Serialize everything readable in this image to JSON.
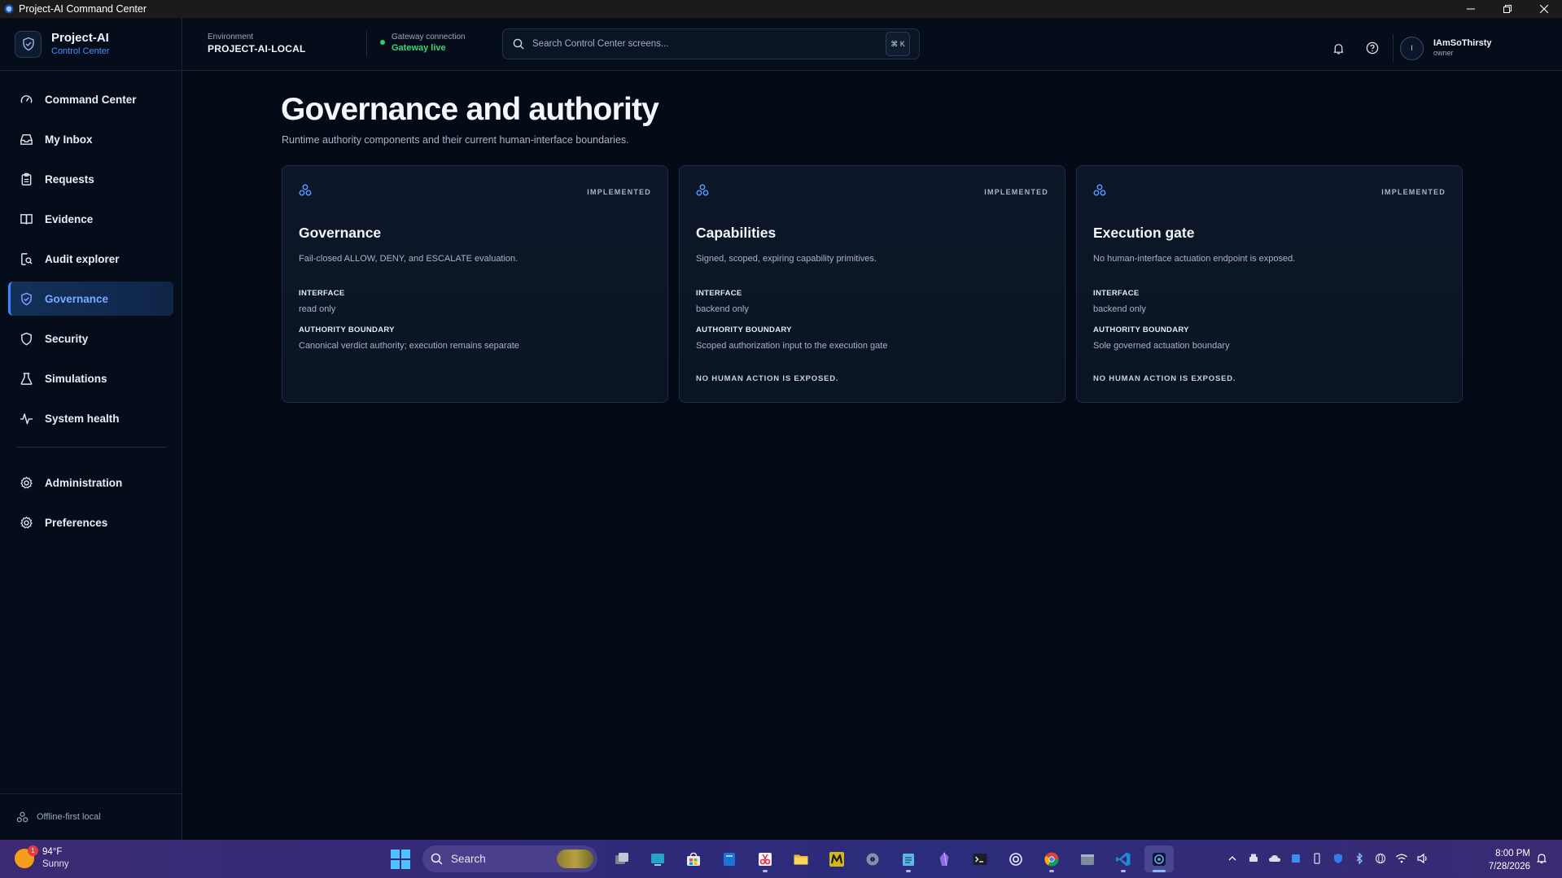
{
  "window": {
    "title": "Project-AI Command Center"
  },
  "brand": {
    "name": "Project-AI",
    "subtitle": "Control Center"
  },
  "sidebar": {
    "items": [
      {
        "label": "Command Center",
        "icon": "gauge-icon"
      },
      {
        "label": "My Inbox",
        "icon": "inbox-icon"
      },
      {
        "label": "Requests",
        "icon": "clipboard-icon"
      },
      {
        "label": "Evidence",
        "icon": "book-icon"
      },
      {
        "label": "Audit explorer",
        "icon": "audit-search-icon"
      },
      {
        "label": "Governance",
        "icon": "shield-check-icon",
        "active": true
      },
      {
        "label": "Security",
        "icon": "shield-icon"
      },
      {
        "label": "Simulations",
        "icon": "flask-icon"
      },
      {
        "label": "System health",
        "icon": "pulse-icon"
      }
    ],
    "secondary_items": [
      {
        "label": "Administration",
        "icon": "gear-icon"
      },
      {
        "label": "Preferences",
        "icon": "gear-icon"
      }
    ],
    "footer": "Offline-first local"
  },
  "header": {
    "environment_label": "Environment",
    "environment_value": "PROJECT-AI-LOCAL",
    "gateway_label": "Gateway connection",
    "gateway_value": "Gateway live",
    "search_placeholder": "Search Control Center screens...",
    "shortcut": "⌘ K",
    "user_initial": "I",
    "user_name": "IAmSoThirsty",
    "user_role": "owner"
  },
  "page": {
    "title": "Governance and authority",
    "subtitle": "Runtime authority components and their current human-interface boundaries."
  },
  "cards": [
    {
      "badge": "IMPLEMENTED",
      "title": "Governance",
      "description": "Fail-closed ALLOW, DENY, and ESCALATE evaluation.",
      "interface_label": "INTERFACE",
      "interface_value": "read only",
      "boundary_label": "AUTHORITY BOUNDARY",
      "boundary_value": "Canonical verdict authority; execution remains separate",
      "note": ""
    },
    {
      "badge": "IMPLEMENTED",
      "title": "Capabilities",
      "description": "Signed, scoped, expiring capability primitives.",
      "interface_label": "INTERFACE",
      "interface_value": "backend only",
      "boundary_label": "AUTHORITY BOUNDARY",
      "boundary_value": "Scoped authorization input to the execution gate",
      "note": "NO HUMAN ACTION IS EXPOSED."
    },
    {
      "badge": "IMPLEMENTED",
      "title": "Execution gate",
      "description": "No human-interface actuation endpoint is exposed.",
      "interface_label": "INTERFACE",
      "interface_value": "backend only",
      "boundary_label": "AUTHORITY BOUNDARY",
      "boundary_value": "Sole governed actuation boundary",
      "note": "NO HUMAN ACTION IS EXPOSED."
    }
  ],
  "taskbar": {
    "weather_temp": "94°F",
    "weather_condition": "Sunny",
    "weather_alert_count": "1",
    "search_label": "Search",
    "time": "8:00 PM",
    "date": "7/28/2026"
  },
  "colors": {
    "accent": "#3f86ff",
    "gateway_live": "#37d67a",
    "background": "#040a16"
  }
}
